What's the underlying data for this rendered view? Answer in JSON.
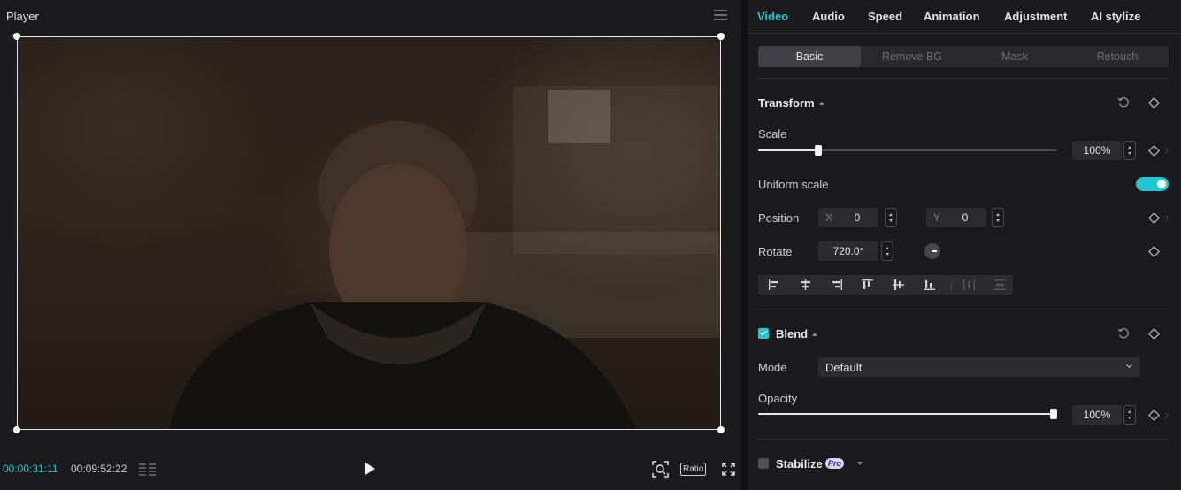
{
  "player": {
    "title": "Player",
    "time_current": "00:00:31:11",
    "time_total": "00:09:52:22",
    "ratio_label": "Ratio"
  },
  "inspector": {
    "tabs": [
      {
        "label": "Video",
        "active": true
      },
      {
        "label": "Audio"
      },
      {
        "label": "Speed"
      },
      {
        "label": "Animation"
      },
      {
        "label": "Adjustment"
      },
      {
        "label": "AI stylize"
      }
    ],
    "subtabs": [
      {
        "label": "Basic",
        "active": true
      },
      {
        "label": "Remove BG"
      },
      {
        "label": "Mask"
      },
      {
        "label": "Retouch"
      }
    ],
    "transform": {
      "title": "Transform",
      "scale_label": "Scale",
      "scale_value": "100%",
      "scale_slider_fraction": 0.2,
      "uniform_scale_label": "Uniform scale",
      "uniform_scale_on": true,
      "position_label": "Position",
      "pos_x_axis": "X",
      "pos_x": "0",
      "pos_y_axis": "Y",
      "pos_y": "0",
      "rotate_label": "Rotate",
      "rotate_value": "720.0°"
    },
    "blend": {
      "title": "Blend",
      "enabled": true,
      "mode_label": "Mode",
      "mode_value": "Default",
      "opacity_label": "Opacity",
      "opacity_value": "100%",
      "opacity_fraction": 1.0
    },
    "stabilize": {
      "title": "Stabilize",
      "badge": "Pro",
      "enabled": false
    }
  },
  "colors": {
    "accent": "#1ec8d2",
    "panel_bg": "#1b1b1e"
  }
}
